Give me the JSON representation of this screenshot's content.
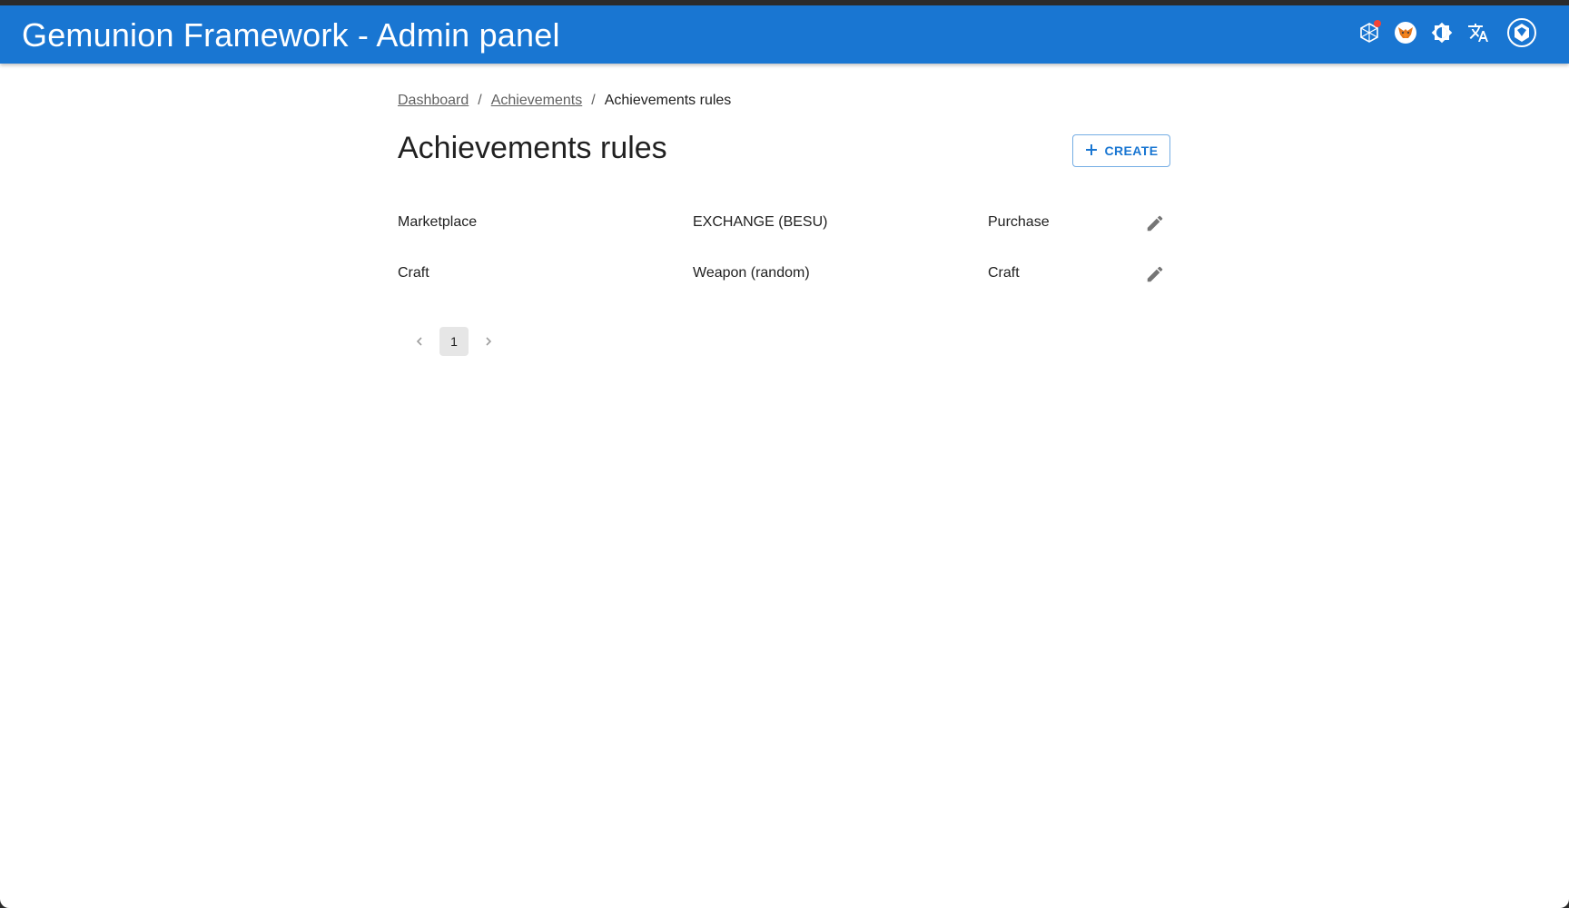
{
  "app": {
    "title": "Gemunion Framework - Admin panel"
  },
  "toolbar": {
    "icons": [
      "network-icon",
      "metamask-fox-icon",
      "brightness-icon",
      "translate-icon",
      "wallet-hexagon-icon"
    ]
  },
  "breadcrumb": {
    "items": [
      {
        "label": "Dashboard"
      },
      {
        "label": "Achievements"
      }
    ],
    "current": "Achievements rules"
  },
  "page": {
    "title": "Achievements rules",
    "create_label": "CREATE"
  },
  "rows": [
    {
      "name": "Marketplace",
      "contract": "EXCHANGE (BESU)",
      "action": "Purchase"
    },
    {
      "name": "Craft",
      "contract": "Weapon (random)",
      "action": "Craft"
    }
  ],
  "pagination": {
    "current_page": "1"
  },
  "colors": {
    "primary": "#1976d2",
    "badge": "#f44336"
  }
}
